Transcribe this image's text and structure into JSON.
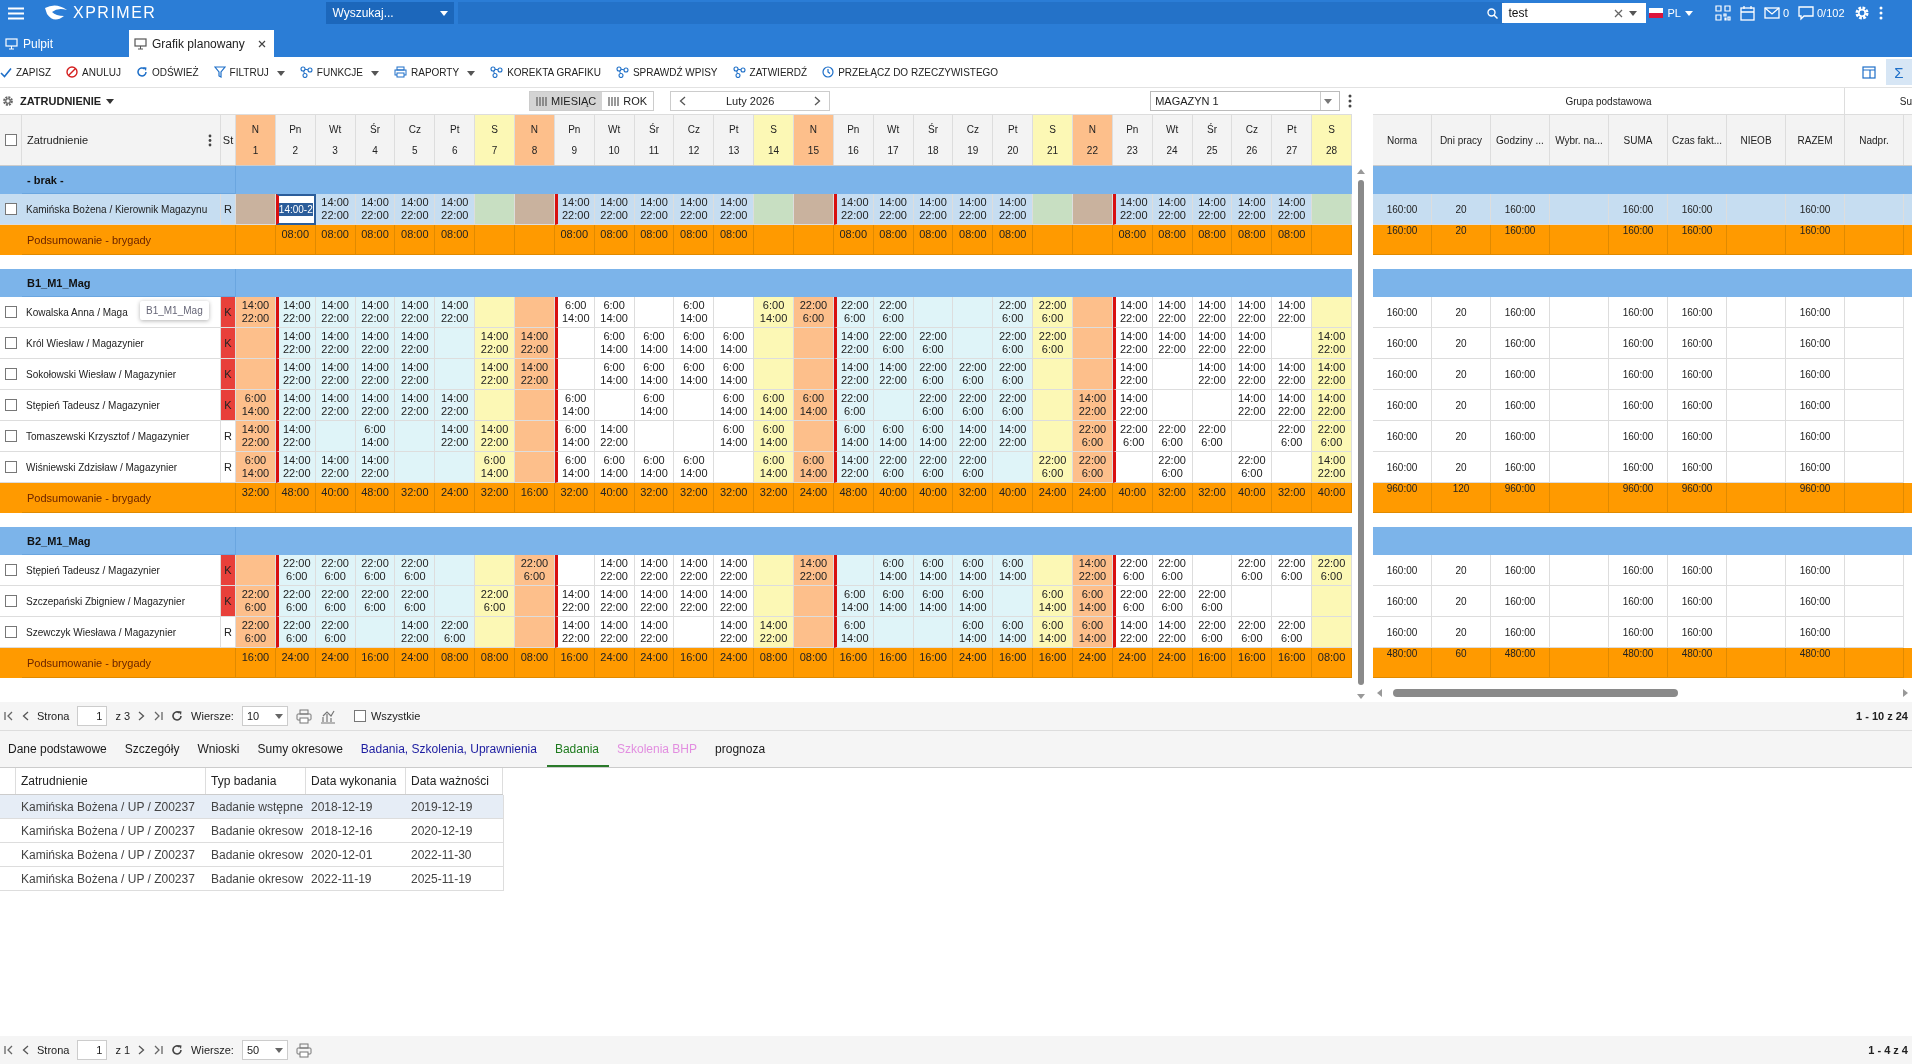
{
  "topbar": {
    "logo": "XPRIMER",
    "scope_select": {
      "label": "Wyszukaj..."
    },
    "user_field": {
      "value": "test"
    },
    "language": "PL",
    "mail_count": "0",
    "messages": "0/102"
  },
  "tabs": [
    {
      "label": "Pulpit",
      "selected": false,
      "closable": false
    },
    {
      "label": "Grafik planowany",
      "selected": true,
      "closable": true
    }
  ],
  "toolbar": [
    {
      "label": "ZAPISZ",
      "kind": "check",
      "dropdown": false
    },
    {
      "label": "ANULUJ",
      "kind": "cancel",
      "dropdown": false
    },
    {
      "label": "ODŚWIEŻ",
      "kind": "refresh",
      "dropdown": false
    },
    {
      "label": "FILTRUJ",
      "kind": "filter",
      "dropdown": true
    },
    {
      "label": "FUNKCJE",
      "kind": "nodes",
      "dropdown": true
    },
    {
      "label": "RAPORTY",
      "kind": "report",
      "dropdown": true
    },
    {
      "label": "KOREKTA GRAFIKU",
      "kind": "nodes",
      "dropdown": false
    },
    {
      "label": "SPRAWDŹ WPISY",
      "kind": "nodes",
      "dropdown": false
    },
    {
      "label": "ZATWIERDŹ",
      "kind": "nodes",
      "dropdown": false
    },
    {
      "label": "PRZEŁĄCZ DO RZECZYWISTEGO",
      "kind": "clock",
      "dropdown": false
    }
  ],
  "sigma_button": {
    "label": "Σ",
    "selected": true
  },
  "view": {
    "employment_label": "ZATRUDNIENIE",
    "modes": [
      {
        "label": "MIESIĄC",
        "selected": true
      },
      {
        "label": "ROK",
        "selected": false
      }
    ],
    "period": "Luty 2026",
    "warehouse": "MAGAZYN 1"
  },
  "grid": {
    "header_checked": false,
    "employment_column": "Zatrudnienie",
    "status_column": "St",
    "days": [
      {
        "weekday": "N",
        "day": "1",
        "kind": "sunday",
        "shaded": false,
        "week_start": false
      },
      {
        "weekday": "Pn",
        "day": "2",
        "kind": "weekday",
        "shaded": true,
        "week_start": true
      },
      {
        "weekday": "Wt",
        "day": "3",
        "kind": "weekday",
        "shaded": true,
        "week_start": false
      },
      {
        "weekday": "Śr",
        "day": "4",
        "kind": "weekday",
        "shaded": true,
        "week_start": false
      },
      {
        "weekday": "Cz",
        "day": "5",
        "kind": "weekday",
        "shaded": true,
        "week_start": false
      },
      {
        "weekday": "Pt",
        "day": "6",
        "kind": "weekday",
        "shaded": true,
        "week_start": false
      },
      {
        "weekday": "S",
        "day": "7",
        "kind": "saturday",
        "shaded": false,
        "week_start": false
      },
      {
        "weekday": "N",
        "day": "8",
        "kind": "sunday",
        "shaded": false,
        "week_start": false
      },
      {
        "weekday": "Pn",
        "day": "9",
        "kind": "weekday",
        "shaded": false,
        "week_start": true
      },
      {
        "weekday": "Wt",
        "day": "10",
        "kind": "weekday",
        "shaded": false,
        "week_start": false
      },
      {
        "weekday": "Śr",
        "day": "11",
        "kind": "weekday",
        "shaded": false,
        "week_start": false
      },
      {
        "weekday": "Cz",
        "day": "12",
        "kind": "weekday",
        "shaded": false,
        "week_start": false
      },
      {
        "weekday": "Pt",
        "day": "13",
        "kind": "weekday",
        "shaded": false,
        "week_start": false
      },
      {
        "weekday": "S",
        "day": "14",
        "kind": "saturday",
        "shaded": false,
        "week_start": false
      },
      {
        "weekday": "N",
        "day": "15",
        "kind": "sunday",
        "shaded": false,
        "week_start": false
      },
      {
        "weekday": "Pn",
        "day": "16",
        "kind": "weekday",
        "shaded": true,
        "week_start": true
      },
      {
        "weekday": "Wt",
        "day": "17",
        "kind": "weekday",
        "shaded": true,
        "week_start": false
      },
      {
        "weekday": "Śr",
        "day": "18",
        "kind": "weekday",
        "shaded": true,
        "week_start": false
      },
      {
        "weekday": "Cz",
        "day": "19",
        "kind": "weekday",
        "shaded": true,
        "week_start": false
      },
      {
        "weekday": "Pt",
        "day": "20",
        "kind": "weekday",
        "shaded": true,
        "week_start": false
      },
      {
        "weekday": "S",
        "day": "21",
        "kind": "saturday",
        "shaded": false,
        "week_start": false
      },
      {
        "weekday": "N",
        "day": "22",
        "kind": "sunday",
        "shaded": false,
        "week_start": false
      },
      {
        "weekday": "Pn",
        "day": "23",
        "kind": "weekday",
        "shaded": false,
        "week_start": true
      },
      {
        "weekday": "Wt",
        "day": "24",
        "kind": "weekday",
        "shaded": false,
        "week_start": false
      },
      {
        "weekday": "Śr",
        "day": "25",
        "kind": "weekday",
        "shaded": false,
        "week_start": false
      },
      {
        "weekday": "Cz",
        "day": "26",
        "kind": "weekday",
        "shaded": false,
        "week_start": false
      },
      {
        "weekday": "Pt",
        "day": "27",
        "kind": "weekday",
        "shaded": false,
        "week_start": false
      },
      {
        "weekday": "S",
        "day": "28",
        "kind": "saturday",
        "shaded": false,
        "week_start": false
      }
    ],
    "totals_group": "Grupa podstawowa",
    "totals_next_group": "Su",
    "totals_columns": [
      {
        "label": "Norma",
        "filled": true
      },
      {
        "label": "Dni pracy",
        "filled": true
      },
      {
        "label": "Godziny ...",
        "filled": true
      },
      {
        "label": "Wybr. na...",
        "filled": false
      },
      {
        "label": "SUMA",
        "filled": true
      },
      {
        "label": "Czas fakt...",
        "filled": true
      },
      {
        "label": "NIEOB",
        "filled": false
      },
      {
        "label": "RAZEM",
        "filled": true
      },
      {
        "label": "Nadpr.",
        "filled": false
      }
    ],
    "groups": [
      {
        "name": "- brak -",
        "rows": [
          {
            "name": "Kamińska Bożena / Kierownik Magazynu",
            "status": "R",
            "flagged": false,
            "selected": true,
            "checked": false,
            "cells": [
              null,
              {
                "value": "14:00-2",
                "editing": true
              },
              "14:00\n22:00",
              "14:00\n22:00",
              "14:00\n22:00",
              "14:00\n22:00",
              null,
              null,
              "14:00\n22:00",
              "14:00\n22:00",
              "14:00\n22:00",
              "14:00\n22:00",
              "14:00\n22:00",
              null,
              null,
              "14:00\n22:00",
              "14:00\n22:00",
              "14:00\n22:00",
              "14:00\n22:00",
              "14:00\n22:00",
              null,
              null,
              "14:00\n22:00",
              "14:00\n22:00",
              "14:00\n22:00",
              "14:00\n22:00",
              "14:00\n22:00",
              null
            ],
            "totals": [
              "160:00",
              "20",
              "160:00",
              "160:00",
              "160:00",
              "160:00"
            ]
          }
        ],
        "summary": {
          "label": "Podsumowanie - brygady",
          "cells": [
            null,
            "08:00",
            "08:00",
            "08:00",
            "08:00",
            "08:00",
            null,
            null,
            "08:00",
            "08:00",
            "08:00",
            "08:00",
            "08:00",
            null,
            null,
            "08:00",
            "08:00",
            "08:00",
            "08:00",
            "08:00",
            null,
            null,
            "08:00",
            "08:00",
            "08:00",
            "08:00",
            "08:00",
            null
          ],
          "totals": [
            "160:00",
            "20",
            "160:00",
            "160:00",
            "160:00",
            "160:00"
          ]
        }
      },
      {
        "name": "B1_M1_Mag",
        "rows": [
          {
            "name": "Kowalska Anna / Maga",
            "tooltip": "B1_M1_Mag",
            "status": "K",
            "flagged": true,
            "selected": false,
            "checked": false,
            "cells": [
              "14:00\n22:00",
              "14:00\n22:00",
              "14:00\n22:00",
              "14:00\n22:00",
              "14:00\n22:00",
              "14:00\n22:00",
              null,
              null,
              "6:00\n14:00",
              "6:00\n14:00",
              null,
              "6:00\n14:00",
              null,
              "6:00\n14:00",
              "22:00\n6:00",
              "22:00\n6:00",
              "22:00\n6:00",
              null,
              null,
              "22:00\n6:00",
              "22:00\n6:00",
              null,
              "14:00\n22:00",
              "14:00\n22:00",
              "14:00\n22:00",
              "14:00\n22:00",
              "14:00\n22:00",
              null
            ],
            "totals": [
              "160:00",
              "20",
              "160:00",
              "160:00",
              "160:00",
              "160:00"
            ]
          },
          {
            "name": "Król Wiesław / Magazynier",
            "status": "K",
            "flagged": true,
            "selected": false,
            "checked": false,
            "cells": [
              null,
              "14:00\n22:00",
              "14:00\n22:00",
              "14:00\n22:00",
              "14:00\n22:00",
              null,
              "14:00\n22:00",
              "14:00\n22:00",
              null,
              "6:00\n14:00",
              "6:00\n14:00",
              "6:00\n14:00",
              "6:00\n14:00",
              null,
              null,
              "14:00\n22:00",
              "22:00\n6:00",
              "22:00\n6:00",
              null,
              "22:00\n6:00",
              "22:00\n6:00",
              null,
              "14:00\n22:00",
              "14:00\n22:00",
              "14:00\n22:00",
              "14:00\n22:00",
              null,
              "14:00\n22:00"
            ],
            "totals": [
              "160:00",
              "20",
              "160:00",
              "160:00",
              "160:00",
              "160:00"
            ]
          },
          {
            "name": "Sokołowski Wiesław / Magazynier",
            "status": "K",
            "flagged": true,
            "selected": false,
            "checked": false,
            "cells": [
              null,
              "14:00\n22:00",
              "14:00\n22:00",
              "14:00\n22:00",
              "14:00\n22:00",
              null,
              "14:00\n22:00",
              "14:00\n22:00",
              null,
              "6:00\n14:00",
              "6:00\n14:00",
              "6:00\n14:00",
              "6:00\n14:00",
              null,
              null,
              "14:00\n22:00",
              "14:00\n22:00",
              "22:00\n6:00",
              "22:00\n6:00",
              "22:00\n6:00",
              null,
              null,
              "14:00\n22:00",
              null,
              "14:00\n22:00",
              "14:00\n22:00",
              "14:00\n22:00",
              "14:00\n22:00"
            ],
            "totals": [
              "160:00",
              "20",
              "160:00",
              "160:00",
              "160:00",
              "160:00"
            ]
          },
          {
            "name": "Stępień Tadeusz / Magazynier",
            "status": "K",
            "flagged": true,
            "selected": false,
            "checked": false,
            "cells": [
              "6:00\n14:00",
              "14:00\n22:00",
              "14:00\n22:00",
              "14:00\n22:00",
              "14:00\n22:00",
              "14:00\n22:00",
              null,
              null,
              "6:00\n14:00",
              null,
              "6:00\n14:00",
              null,
              "6:00\n14:00",
              "6:00\n14:00",
              "6:00\n14:00",
              "22:00\n6:00",
              null,
              "22:00\n6:00",
              "22:00\n6:00",
              "22:00\n6:00",
              null,
              "14:00\n22:00",
              "14:00\n22:00",
              null,
              null,
              "14:00\n22:00",
              "14:00\n22:00",
              "14:00\n22:00"
            ],
            "totals": [
              "160:00",
              "20",
              "160:00",
              "160:00",
              "160:00",
              "160:00"
            ]
          },
          {
            "name": "Tomaszewski Krzysztof / Magazynier",
            "status": "R",
            "flagged": false,
            "selected": false,
            "checked": false,
            "cells": [
              "14:00\n22:00",
              "14:00\n22:00",
              null,
              "6:00\n14:00",
              null,
              "14:00\n22:00",
              "14:00\n22:00",
              null,
              "6:00\n14:00",
              "14:00\n22:00",
              null,
              null,
              "6:00\n14:00",
              "6:00\n14:00",
              null,
              "6:00\n14:00",
              "6:00\n14:00",
              "6:00\n14:00",
              "14:00\n22:00",
              "14:00\n22:00",
              null,
              "22:00\n6:00",
              "22:00\n6:00",
              "22:00\n6:00",
              "22:00\n6:00",
              null,
              "22:00\n6:00",
              "22:00\n6:00"
            ],
            "totals": [
              "160:00",
              "20",
              "160:00",
              "160:00",
              "160:00",
              "160:00"
            ]
          },
          {
            "name": "Wiśniewski Zdzisław / Magazynier",
            "status": "R",
            "flagged": false,
            "selected": false,
            "checked": false,
            "cells": [
              "6:00\n14:00",
              "14:00\n22:00",
              "14:00\n22:00",
              "14:00\n22:00",
              null,
              null,
              "6:00\n14:00",
              null,
              "6:00\n14:00",
              "6:00\n14:00",
              "6:00\n14:00",
              "6:00\n14:00",
              null,
              "6:00\n14:00",
              "6:00\n14:00",
              "14:00\n22:00",
              "22:00\n6:00",
              "22:00\n6:00",
              "22:00\n6:00",
              null,
              "22:00\n6:00",
              "22:00\n6:00",
              null,
              "22:00\n6:00",
              null,
              "22:00\n6:00",
              null,
              "14:00\n22:00"
            ],
            "totals": [
              "160:00",
              "20",
              "160:00",
              "160:00",
              "160:00",
              "160:00"
            ]
          }
        ],
        "summary": {
          "label": "Podsumowanie - brygady",
          "cells": [
            "32:00",
            "48:00",
            "40:00",
            "48:00",
            "32:00",
            "24:00",
            "32:00",
            "16:00",
            "32:00",
            "40:00",
            "32:00",
            "32:00",
            "32:00",
            "32:00",
            "24:00",
            "48:00",
            "40:00",
            "40:00",
            "32:00",
            "40:00",
            "24:00",
            "24:00",
            "40:00",
            "32:00",
            "32:00",
            "40:00",
            "32:00",
            "40:00"
          ],
          "totals": [
            "960:00",
            "120",
            "960:00",
            "960:00",
            "960:00",
            "960:00"
          ]
        }
      },
      {
        "name": "B2_M1_Mag",
        "rows": [
          {
            "name": "Stępień Tadeusz / Magazynier",
            "status": "K",
            "flagged": true,
            "selected": false,
            "checked": false,
            "cells": [
              null,
              "22:00\n6:00",
              "22:00\n6:00",
              "22:00\n6:00",
              "22:00\n6:00",
              null,
              null,
              "22:00\n6:00",
              null,
              "14:00\n22:00",
              "14:00\n22:00",
              "14:00\n22:00",
              "14:00\n22:00",
              null,
              "14:00\n22:00",
              null,
              "6:00\n14:00",
              "6:00\n14:00",
              "6:00\n14:00",
              "6:00\n14:00",
              null,
              "14:00\n22:00",
              "22:00\n6:00",
              "22:00\n6:00",
              null,
              "22:00\n6:00",
              "22:00\n6:00",
              "22:00\n6:00"
            ],
            "totals": [
              "160:00",
              "20",
              "160:00",
              "160:00",
              "160:00",
              "160:00"
            ]
          },
          {
            "name": "Szczepański Zbigniew / Magazynier",
            "status": "K",
            "flagged": true,
            "selected": false,
            "checked": false,
            "cells": [
              "22:00\n6:00",
              "22:00\n6:00",
              "22:00\n6:00",
              "22:00\n6:00",
              "22:00\n6:00",
              null,
              "22:00\n6:00",
              null,
              "14:00\n22:00",
              "14:00\n22:00",
              "14:00\n22:00",
              "14:00\n22:00",
              "14:00\n22:00",
              null,
              null,
              "6:00\n14:00",
              "6:00\n14:00",
              "6:00\n14:00",
              "6:00\n14:00",
              null,
              "6:00\n14:00",
              "6:00\n14:00",
              "22:00\n6:00",
              "22:00\n6:00",
              "22:00\n6:00",
              null,
              null,
              null
            ],
            "totals": [
              "160:00",
              "20",
              "160:00",
              "160:00",
              "160:00",
              "160:00"
            ]
          },
          {
            "name": "Szewczyk Wiesława / Magazynier",
            "status": "R",
            "flagged": false,
            "selected": false,
            "checked": false,
            "cells": [
              "22:00\n6:00",
              "22:00\n6:00",
              "22:00\n6:00",
              null,
              "14:00\n22:00",
              "22:00\n6:00",
              null,
              null,
              "14:00\n22:00",
              "14:00\n22:00",
              "14:00\n22:00",
              null,
              "14:00\n22:00",
              "14:00\n22:00",
              null,
              "6:00\n14:00",
              null,
              null,
              "6:00\n14:00",
              "6:00\n14:00",
              "6:00\n14:00",
              "6:00\n14:00",
              "14:00\n22:00",
              "14:00\n22:00",
              "22:00\n6:00",
              "22:00\n6:00",
              "22:00\n6:00",
              null
            ],
            "totals": [
              "160:00",
              "20",
              "160:00",
              "160:00",
              "160:00",
              "160:00"
            ]
          }
        ],
        "summary": {
          "label": "Podsumowanie - brygady",
          "cells": [
            "16:00",
            "24:00",
            "24:00",
            "16:00",
            "24:00",
            "08:00",
            "08:00",
            "08:00",
            "16:00",
            "24:00",
            "24:00",
            "16:00",
            "24:00",
            "08:00",
            "08:00",
            "16:00",
            "16:00",
            "16:00",
            "24:00",
            "16:00",
            "16:00",
            "24:00",
            "24:00",
            "24:00",
            "16:00",
            "16:00",
            "16:00",
            "08:00"
          ],
          "totals": [
            "480:00",
            "60",
            "480:00",
            "480:00",
            "480:00",
            "480:00"
          ]
        }
      }
    ]
  },
  "pager": {
    "page_label": "Strona",
    "page": "1",
    "page_count": "z 3",
    "rows_label": "Wiersze:",
    "rows": "10",
    "all_label": "Wszystkie",
    "all_checked": false,
    "range": "1 - 10 z 24"
  },
  "detail_tabs": [
    {
      "label": "Dane podstawowe",
      "selected": false,
      "color": "#1a1a1a"
    },
    {
      "label": "Szczegóły",
      "selected": false,
      "color": "#1a1a1a"
    },
    {
      "label": "Wnioski",
      "selected": false,
      "color": "#1a1a1a"
    },
    {
      "label": "Sumy okresowe",
      "selected": false,
      "color": "#1a1a1a"
    },
    {
      "label": "Badania, Szkolenia, Uprawnienia",
      "selected": false,
      "color": "#1c1ca0"
    },
    {
      "label": "Badania",
      "selected": true,
      "color": "#1d7a1d"
    },
    {
      "label": "Szkolenia BHP",
      "selected": false,
      "color": "#e28ee0"
    },
    {
      "label": "prognoza",
      "selected": false,
      "color": "#1a1a1a"
    }
  ],
  "detail_table": {
    "columns": [
      "Zatrudnienie",
      "Typ badania",
      "Data wykonania",
      "Data ważności"
    ],
    "rows": [
      {
        "selected": true,
        "cells": [
          "Kamińska Bożena / UP / Z00237",
          "Badanie wstępne",
          "2018-12-19",
          "2019-12-19"
        ]
      },
      {
        "selected": false,
        "cells": [
          "Kamińska Bożena / UP / Z00237",
          "Badanie okresow",
          "2018-12-16",
          "2020-12-19"
        ]
      },
      {
        "selected": false,
        "cells": [
          "Kamińska Bożena / UP / Z00237",
          "Badanie okresow",
          "2020-12-01",
          "2022-11-30"
        ]
      },
      {
        "selected": false,
        "cells": [
          "Kamińska Bożena / UP / Z00237",
          "Badanie okresow",
          "2022-11-19",
          "2025-11-19"
        ]
      }
    ]
  },
  "detail_pager": {
    "page_label": "Strona",
    "page": "1",
    "page_count": "z 1",
    "rows_label": "Wiersze:",
    "rows": "50",
    "range": "1 - 4 z 4"
  }
}
